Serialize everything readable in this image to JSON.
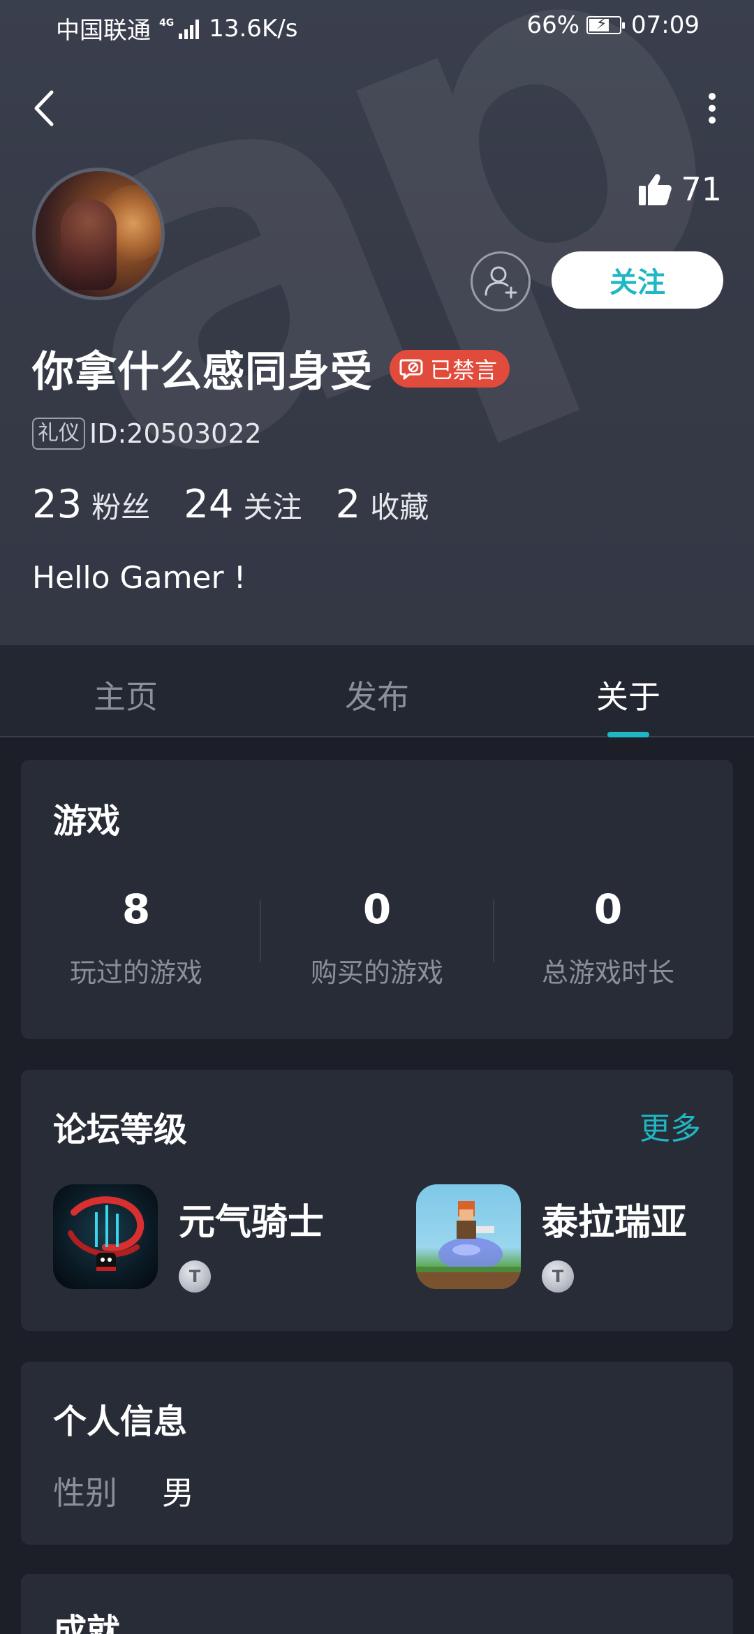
{
  "status_bar": {
    "carrier": "中国联通",
    "network_type": "4G",
    "speed": "13.6K/s",
    "battery": "66%",
    "battery_level": 0.66,
    "time": "07:09"
  },
  "profile": {
    "likes": "71",
    "follow_label": "关注",
    "username": "你拿什么感同身受",
    "banned_label": "已禁言",
    "title_badge": "礼仪",
    "user_id": "ID:20503022",
    "stats": [
      {
        "num": "23",
        "label": "粉丝"
      },
      {
        "num": "24",
        "label": "关注"
      },
      {
        "num": "2",
        "label": "收藏"
      }
    ],
    "bio": "Hello Gamer !",
    "watermark": "apTa"
  },
  "tabs": [
    {
      "label": "主页",
      "active": false
    },
    {
      "label": "发布",
      "active": false
    },
    {
      "label": "关于",
      "active": true
    }
  ],
  "games": {
    "title": "游戏",
    "stats": [
      {
        "num": "8",
        "label": "玩过的游戏"
      },
      {
        "num": "0",
        "label": "购买的游戏"
      },
      {
        "num": "0",
        "label": "总游戏时长"
      }
    ]
  },
  "forum": {
    "title": "论坛等级",
    "more_label": "更多",
    "items": [
      {
        "name": "元气骑士",
        "level_badge": "T"
      },
      {
        "name": "泰拉瑞亚",
        "level_badge": "T"
      }
    ]
  },
  "personal_info": {
    "title": "个人信息",
    "gender_label": "性别",
    "gender_value": "男"
  },
  "achievements": {
    "title": "成就"
  },
  "colors": {
    "accent": "#1fb7c3",
    "banned": "#e14b3c",
    "card_bg": "#282c37",
    "page_bg": "#1c1f28"
  }
}
